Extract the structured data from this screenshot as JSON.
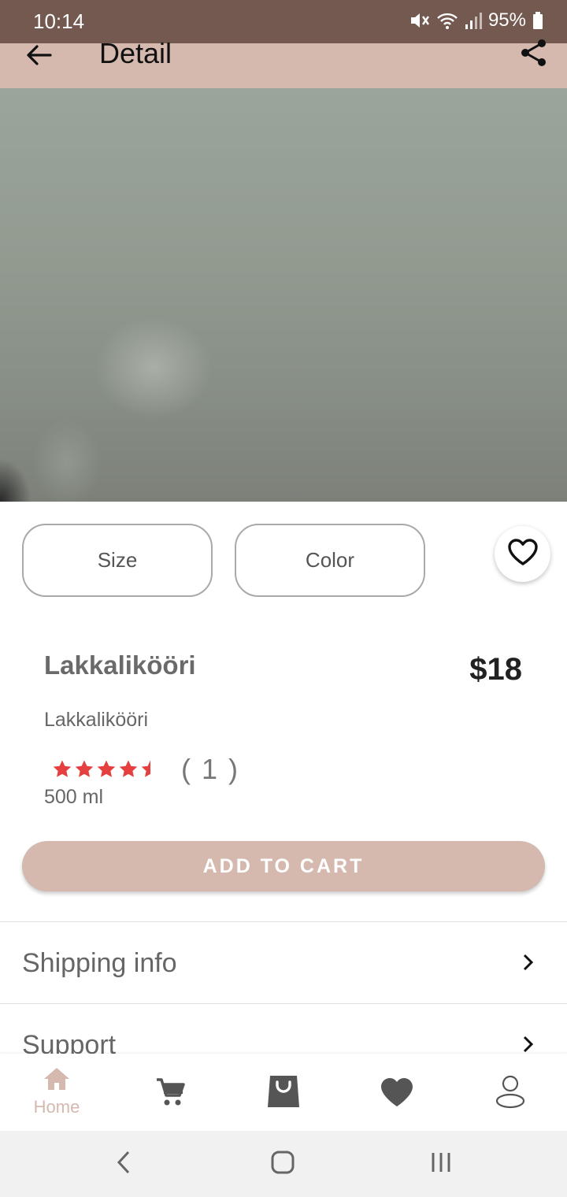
{
  "status_bar": {
    "time": "10:14",
    "battery": "95%",
    "icons": [
      "mute-icon",
      "wifi-icon",
      "signal-icon",
      "battery-icon"
    ]
  },
  "app_bar": {
    "title": "Detail",
    "back_icon": "arrow-left-icon",
    "share_icon": "share-icon"
  },
  "options": {
    "size_label": "Size",
    "color_label": "Color",
    "favorite_icon": "heart-outline-icon"
  },
  "product": {
    "name": "Lakkalikööri",
    "price": "$18",
    "subtitle": "Lakkalikööri",
    "rating_value": 4.5,
    "rating_max": 5,
    "review_count": "( 1 )",
    "volume": "500 ml"
  },
  "cart_button": {
    "label": "ADD TO CART"
  },
  "list": {
    "shipping_label": "Shipping info",
    "support_label": "Support"
  },
  "bottom_nav": {
    "home_label": "Home",
    "items": [
      "home-icon",
      "cart-icon",
      "shopping-bag-icon",
      "heart-icon",
      "profile-icon"
    ]
  },
  "colors": {
    "status_bar": "#735950",
    "accent": "#d5b9ae",
    "star": "#e53f3f",
    "icon_dark": "#555555"
  }
}
